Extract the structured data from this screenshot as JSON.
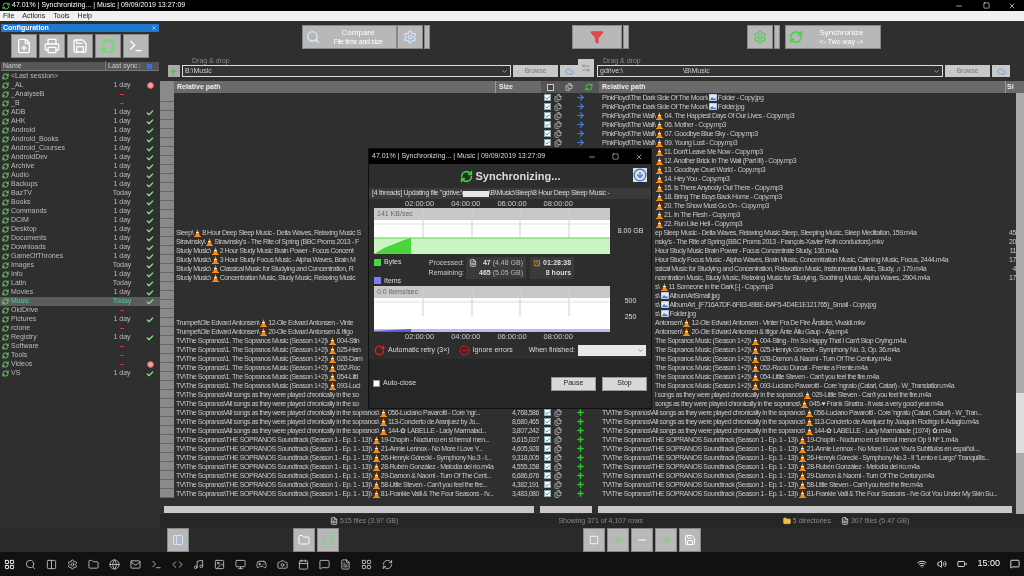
{
  "window": {
    "title": "47.01% | Synchronizing... | Music | 09/09/2019 13:27:09"
  },
  "menu": [
    "File",
    "Actions",
    "Tools",
    "Help"
  ],
  "config_panel": {
    "title": "Configuration",
    "columns": [
      "Name",
      "Last sync"
    ],
    "items": [
      {
        "name": "<Last session>",
        "never_synced": false,
        "synced": false,
        "failed": false,
        "selected": false
      },
      {
        "name": "_AL",
        "last_sync": "1 day",
        "never_synced": false,
        "synced": false,
        "failed": true,
        "selected": false
      },
      {
        "name": "_AnalyseB",
        "never_synced": true,
        "synced": false,
        "failed": false,
        "selected": false
      },
      {
        "name": "_B",
        "never_synced": true,
        "synced": false,
        "failed": false,
        "selected": false
      },
      {
        "name": "ADB",
        "last_sync": "1 day",
        "never_synced": false,
        "synced": true,
        "failed": false,
        "selected": false
      },
      {
        "name": "AHK",
        "last_sync": "1 day",
        "never_synced": false,
        "synced": true,
        "failed": false,
        "selected": false
      },
      {
        "name": "Android",
        "last_sync": "1 day",
        "never_synced": false,
        "synced": true,
        "failed": false,
        "selected": false
      },
      {
        "name": "Android_Books",
        "last_sync": "1 day",
        "never_synced": false,
        "synced": true,
        "failed": false,
        "selected": false
      },
      {
        "name": "Android_Courses",
        "last_sync": "1 day",
        "never_synced": false,
        "synced": true,
        "failed": false,
        "selected": false
      },
      {
        "name": "AndroidDev",
        "last_sync": "1 day",
        "never_synced": false,
        "synced": true,
        "failed": false,
        "selected": false
      },
      {
        "name": "Archive",
        "last_sync": "1 day",
        "never_synced": false,
        "synced": true,
        "failed": false,
        "selected": false
      },
      {
        "name": "Audio",
        "last_sync": "1 day",
        "never_synced": false,
        "synced": true,
        "failed": false,
        "selected": false
      },
      {
        "name": "Backups",
        "last_sync": "1 day",
        "never_synced": false,
        "synced": true,
        "failed": false,
        "selected": false
      },
      {
        "name": "BazTV",
        "last_sync": "Today",
        "never_synced": false,
        "synced": true,
        "failed": false,
        "selected": false
      },
      {
        "name": "Books",
        "last_sync": "1 day",
        "never_synced": false,
        "synced": true,
        "failed": false,
        "selected": false
      },
      {
        "name": "Commands",
        "last_sync": "1 day",
        "never_synced": false,
        "synced": true,
        "failed": false,
        "selected": false
      },
      {
        "name": "DCIM",
        "last_sync": "1 day",
        "never_synced": false,
        "synced": true,
        "failed": false,
        "selected": false
      },
      {
        "name": "Desktop",
        "last_sync": "1 day",
        "never_synced": false,
        "synced": true,
        "failed": false,
        "selected": false
      },
      {
        "name": "Documents",
        "last_sync": "1 day",
        "never_synced": false,
        "synced": true,
        "failed": false,
        "selected": false
      },
      {
        "name": "Downloads",
        "last_sync": "1 day",
        "never_synced": false,
        "synced": true,
        "failed": false,
        "selected": false
      },
      {
        "name": "GameOfThrones",
        "last_sync": "1 day",
        "never_synced": false,
        "synced": true,
        "failed": false,
        "selected": false
      },
      {
        "name": "Images",
        "last_sync": "Today",
        "never_synced": false,
        "synced": true,
        "failed": false,
        "selected": false
      },
      {
        "name": "Info",
        "last_sync": "1 day",
        "never_synced": false,
        "synced": true,
        "failed": false,
        "selected": false
      },
      {
        "name": "Latin",
        "last_sync": "Today",
        "never_synced": false,
        "synced": true,
        "failed": false,
        "selected": false
      },
      {
        "name": "Movies",
        "last_sync": "1 day",
        "never_synced": false,
        "synced": true,
        "failed": false,
        "selected": false
      },
      {
        "name": "Music",
        "last_sync": "Today",
        "never_synced": false,
        "synced": true,
        "failed": false,
        "selected": true
      },
      {
        "name": "OldDrive",
        "never_synced": true,
        "synced": false,
        "failed": false,
        "selected": false
      },
      {
        "name": "Pictures",
        "last_sync": "1 day",
        "never_synced": false,
        "synced": true,
        "failed": false,
        "selected": false
      },
      {
        "name": "rclone",
        "never_synced": true,
        "synced": false,
        "failed": false,
        "selected": false
      },
      {
        "name": "Registry",
        "last_sync": "1 day",
        "never_synced": false,
        "synced": true,
        "failed": false,
        "selected": false
      },
      {
        "name": "Software",
        "never_synced": true,
        "synced": false,
        "failed": false,
        "selected": false
      },
      {
        "name": "Tools",
        "never_synced": true,
        "synced": false,
        "failed": false,
        "selected": false
      },
      {
        "name": "Videos",
        "never_synced": true,
        "synced": false,
        "failed": true,
        "selected": false
      },
      {
        "name": "VS",
        "last_sync": "1 day",
        "never_synced": false,
        "synced": true,
        "failed": false,
        "selected": false
      }
    ]
  },
  "toolbar": {
    "compare": {
      "label": "Compare",
      "sublabel": "File time and size"
    },
    "sync": {
      "label": "Synchronize",
      "sublabel": "<- Two way ->"
    }
  },
  "left_folder": {
    "hint": "Drag & drop",
    "value": "B:\\Music",
    "browse": "Browse"
  },
  "right_folder": {
    "hint": "Drag & drop",
    "value_parts": [
      "gdrive:\\",
      "\\B\\Music"
    ],
    "browse": "Browse"
  },
  "grid": {
    "left_columns": [
      "Relative path",
      "Size"
    ],
    "right_columns": [
      "Relative path",
      "Si"
    ],
    "rows": [
      {
        "checked": true,
        "new_file": false,
        "right": {
          "dir": "PinkFloyd\\The Dark Side Of The Moon\\",
          "kind": "image",
          "file": "Folder - Copy.jpg"
        }
      },
      {
        "checked": true,
        "new_file": false,
        "right": {
          "dir": "PinkFloyd\\The Dark Side Of The Moon\\",
          "kind": "image",
          "file": "Folder.jpg"
        }
      },
      {
        "checked": true,
        "new_file": false,
        "right": {
          "dir": "PinkFloyd\\The Wall\\",
          "kind": "audio",
          "file": "04. The Happiest Days Of Our Lives - Copy.mp3"
        }
      },
      {
        "checked": true,
        "new_file": false,
        "right": {
          "dir": "PinkFloyd\\The Wall\\",
          "kind": "audio",
          "file": "06. Mother - Copy.mp3"
        }
      },
      {
        "checked": true,
        "new_file": false,
        "right": {
          "dir": "PinkFloyd\\The Wall\\",
          "kind": "audio",
          "file": "07. Goodbye Blue Sky - Copy.mp3"
        }
      },
      {
        "checked": true,
        "new_file": false,
        "right": {
          "dir": "PinkFloyd\\The Wall\\",
          "kind": "audio",
          "file": "09. Young Lust - Copy.mp3"
        }
      },
      {
        "right": {
          "kind": "audio",
          "file": "11. Don't Leave Me Now - Copy.mp3"
        }
      },
      {
        "right": {
          "kind": "audio",
          "file": "12. Another Brick In The Wall (Part III) - Copy.mp3"
        }
      },
      {
        "right": {
          "kind": "audio",
          "file": "13. Goodbye Cruel World - Copy.mp3"
        }
      },
      {
        "right": {
          "kind": "audio",
          "file": "14. Hey You - Copy.mp3"
        }
      },
      {
        "right": {
          "kind": "audio",
          "file": "15. Is There Anybody Out There - Copy.mp3"
        }
      },
      {
        "right": {
          "kind": "audio",
          "file": "18. Bring The Boys Back Home - Copy.mp3"
        }
      },
      {
        "right": {
          "kind": "audio",
          "file": "20. The Show Must Go On - Copy.mp3"
        }
      },
      {
        "right": {
          "kind": "audio",
          "file": "21. In The Flesh - Copy.mp3"
        }
      },
      {
        "right": {
          "kind": "audio",
          "file": "22. Run Like Hell - Copy.mp3"
        }
      },
      {
        "left": {
          "dir": "Sleep\\",
          "kind": "audio",
          "file": "8 Hour Deep Sleep Music - Delta Waves, Relaxing Music S"
        },
        "right": {
          "file": "ep Sleep Music - Delta Waves, Relaxing Music Sleep, Sleeping Music, Sleep Meditation, 159.m4a"
        },
        "right_size": "45"
      },
      {
        "left": {
          "dir": "Stravinsky\\",
          "kind": "audio",
          "file": "Stravinsky's - The Rite of Spring (BBC Proms 2013 - F"
        },
        "right": {
          "file": "nsky's - The Rite of Spring (BBC Proms 2013 - François-Xavier Roth conductors).mkv"
        },
        "right_size": "20"
      },
      {
        "left": {
          "dir": "Study Music\\",
          "kind": "audio",
          "file": "2 Hour Study Music Brain Power - Focus Concent"
        },
        "right": {
          "file": "Hour Study Music Brain Power - Focus Concentrate Study, 130.m4a"
        },
        "right_size": "11"
      },
      {
        "left": {
          "dir": "Study Music\\",
          "kind": "audio",
          "file": "3 Hour Study Focus Music - Alpha Waves, Brain M"
        },
        "right": {
          "file": "Hour Study Focus Music - Alpha Waves, Brain Music, Concentration Music, Calming Music, Focus, 2444.m4a"
        },
        "right_size": "17"
      },
      {
        "left": {
          "dir": "Study Music\\",
          "kind": "audio",
          "file": "Classical Music for Studying and Concentration, R"
        },
        "right": {
          "file": "ssical Music for Studying and Concentration, Relaxation Music, Instrumental Music, Study, ♬179.m4a"
        },
        "right_size": "4"
      },
      {
        "left": {
          "dir": "Study Music\\",
          "kind": "audio",
          "file": "Concentration Music, Study Music, Relaxing Music"
        },
        "right": {
          "file": "ncentration Music, Study Music, Relaxing Music for Studying, Soothing Music, Alpha Waves, 2904.m4a"
        },
        "right_size": "17"
      },
      {
        "right": {
          "dir": "s\\",
          "kind": "audio",
          "file": "11 Someone in the Dark [-] - Copy.mp3"
        }
      },
      {
        "right": {
          "dir": "s\\",
          "kind": "image",
          "file": "AlbumArtSmall.jpg"
        }
      },
      {
        "right": {
          "dir": "s\\",
          "kind": "image",
          "file": "AlbumArt_{F716A7DF-6F83-49BE-BAF5-4D4E1E121765}_Small - Copy.jpg"
        }
      },
      {
        "right": {
          "dir": "s\\",
          "kind": "image",
          "file": "Folder.jpg"
        }
      },
      {
        "left": {
          "dir": "Trumpet\\Ole Edvard Antonsen\\",
          "kind": "audio",
          "file": "12-Ole Edvard Antonsen - Vinte"
        },
        "right": {
          "dir": "Antonsen\\",
          "kind": "audio",
          "file": "12-Ole Edvard Antonsen - Vinter Fra De Fire Årstider, Vivaldi.mkv"
        }
      },
      {
        "left": {
          "dir": "Trumpet\\Ole Edvard Antonsen\\",
          "kind": "audio",
          "file": "20-Ole Edvard Antonsen & Ifigo"
        },
        "right": {
          "dir": "Antonsen\\",
          "kind": "audio",
          "file": "20-Ole Edvard Antonsen & Ifigor Ánte Áilu Gaup - Ája.mp4"
        }
      },
      {
        "left": {
          "dir": "TV\\The Sopranos\\1. The Sopranos Music (Season 1+2)\\",
          "kind": "audio",
          "file": "004-Stin"
        },
        "right": {
          "dir": "The Sopranos Music (Season 1+2)\\",
          "kind": "audio",
          "file": "004-Sting - I'm So Happy That I Can't Stop Crying.m4a"
        }
      },
      {
        "left": {
          "dir": "TV\\The Sopranos\\1. The Sopranos Music (Season 1+2)\\",
          "kind": "audio",
          "file": "025-Hen"
        },
        "right": {
          "dir": "The Sopranos Music (Season 1+2)\\",
          "kind": "audio",
          "file": "025-Henryk Górecki - Symphony No. 3, Op. 36.m4a"
        }
      },
      {
        "left": {
          "dir": "TV\\The Sopranos\\1. The Sopranos Music (Season 1+2)\\",
          "kind": "audio",
          "file": "028-Dam"
        },
        "right": {
          "dir": "The Sopranos Music (Season 1+2)\\",
          "kind": "audio",
          "file": "028-Damon & Naomi - Turn Of The Century.m4a"
        }
      },
      {
        "left": {
          "dir": "TV\\The Sopranos\\1. The Sopranos Music (Season 1+2)\\",
          "kind": "audio",
          "file": "052-Roc"
        },
        "right": {
          "dir": "The Sopranos Music (Season 1+2)\\",
          "kind": "audio",
          "file": "052-Rocío Dúrcal - Frente a Frente.m4a"
        }
      },
      {
        "left": {
          "dir": "TV\\The Sopranos\\1. The Sopranos Music (Season 1+2)\\",
          "kind": "audio",
          "file": "054-Littl"
        },
        "right": {
          "dir": "The Sopranos Music (Season 1+2)\\",
          "kind": "audio",
          "file": "054-Little Steven - Can't you feel the fire.m4a"
        }
      },
      {
        "left": {
          "dir": "TV\\The Sopranos\\1. The Sopranos Music (Season 1+2)\\",
          "kind": "audio",
          "file": "093-Luci"
        },
        "right": {
          "dir": "The Sopranos Music (Season 1+2)\\",
          "kind": "audio",
          "file": "093-Luciano Pavarotti - Core 'ngrato (Catari, Catari) - W_Translation.m4a"
        }
      },
      {
        "left": {
          "dir": "TV\\The Sopranos\\All songs as they were played chronically in the so"
        },
        "right": {
          "dir": "l songs as they were played chronically in the sopranos\\",
          "kind": "audio",
          "file": "029-Little Steven - Can't you feel the fire.m4a"
        }
      },
      {
        "left": {
          "dir": "TV\\The Sopranos\\All songs as they were played chronically in the so"
        },
        "right": {
          "dir": "songs as they were played chronically in the sopranos\\",
          "kind": "audio",
          "file": "045-♥ Frank Sinatra - It was a very good year.m4a"
        }
      },
      {
        "left": {
          "dir": "TV\\The Sopranos\\All songs as they were played chronically in the sopranos\\",
          "kind": "audio",
          "file": "056-Luciano Pavarotti - Core 'ngr..."
        },
        "size": "4,768,586",
        "checked": true,
        "new_file": true,
        "right": {
          "dir": "TV\\The Sopranos\\All songs as they were played chronically in the sopranos\\",
          "kind": "audio",
          "file": "056-Luciano Pavarotti - Core 'ngrato (Catari, Catari) - W_Tran..."
        }
      },
      {
        "left": {
          "dir": "TV\\The Sopranos\\All songs as they were played chronically in the sopranos\\",
          "kind": "audio",
          "file": "113-Concierto de Aranjuez by Jo..."
        },
        "size": "8,680,465",
        "checked": true,
        "new_file": true,
        "right": {
          "dir": "TV\\The Sopranos\\All songs as they were played chronically in the sopranos\\",
          "kind": "audio",
          "file": "113-Concierto de Aranjuez by Joaquín Rodrigo II-Adagio.m4a"
        }
      },
      {
        "left": {
          "dir": "TV\\The Sopranos\\All songs as they were played chronically in the sopranos\\",
          "kind": "audio",
          "file": "144-✿ LABELLE - Lady Marmalad..."
        },
        "size": "3,807,242",
        "checked": true,
        "new_file": true,
        "right": {
          "dir": "TV\\The Sopranos\\All songs as they were played chronically in the sopranos\\",
          "kind": "audio",
          "file": "144-✿ LABELLE - Lady Marmalade (1974) ✿.m4a"
        }
      },
      {
        "left": {
          "dir": "TV\\The Sopranos\\THE SOPRANOS Soundtrack (Season 1 - Ep. 1 - 13)\\",
          "kind": "audio",
          "file": "19-Chopin - Nocturno en si bemol men..."
        },
        "size": "5,615,037",
        "checked": true,
        "new_file": true,
        "right": {
          "dir": "TV\\The Sopranos\\THE SOPRANOS Soundtrack (Season 1 - Ep. 1 - 13)\\",
          "kind": "audio",
          "file": "19-Chopin - Nocturno en si bemol menor Op 9 Nº 1.m4a"
        }
      },
      {
        "left": {
          "dir": "TV\\The Sopranos\\THE SOPRANOS Soundtrack (Season 1 - Ep. 1 - 13)\\",
          "kind": "audio",
          "file": "21-Annie Lennox   -   No More I Love Y..."
        },
        "size": "4,605,928",
        "checked": true,
        "new_file": true,
        "right": {
          "dir": "TV\\The Sopranos\\THE SOPRANOS Soundtrack (Season 1 - Ep. 1 - 13)\\",
          "kind": "audio",
          "file": "21-Annie Lennox   -   No More I Love You's   Subtitulos en español...."
        }
      },
      {
        "left": {
          "dir": "TV\\The Sopranos\\THE SOPRANOS Soundtrack (Season 1 - Ep. 1 - 13)\\",
          "kind": "audio",
          "file": "26-Henryk Górecki - Symphony No.3 - I..."
        },
        "size": "9,318,005",
        "checked": true,
        "new_file": true,
        "right": {
          "dir": "TV\\The Sopranos\\THE SOPRANOS Soundtrack (Season 1 - Ep. 1 - 13)\\",
          "kind": "audio",
          "file": "26-Henryk Górecki - Symphony No.3 - II ''Lento e Largo'' Tranquillis..."
        }
      },
      {
        "left": {
          "dir": "TV\\The Sopranos\\THE SOPRANOS Soundtrack (Season 1 - Ep. 1 - 13)\\",
          "kind": "audio",
          "file": "28-Rubén González - Melodía del río.m4a"
        },
        "size": "4,555,158",
        "checked": true,
        "new_file": true,
        "right": {
          "dir": "TV\\The Sopranos\\THE SOPRANOS Soundtrack (Season 1 - Ep. 1 - 13)\\",
          "kind": "audio",
          "file": "28-Rubén González - Melodía del río.m4a"
        }
      },
      {
        "left": {
          "dir": "TV\\The Sopranos\\THE SOPRANOS Soundtrack (Season 1 - Ep. 1 - 13)\\",
          "kind": "audio",
          "file": "29-Damon & Naomi - Turn Of The Cent..."
        },
        "size": "6,686,676",
        "checked": true,
        "new_file": true,
        "right": {
          "dir": "TV\\The Sopranos\\THE SOPRANOS Soundtrack (Season 1 - Ep. 1 - 13)\\",
          "kind": "audio",
          "file": "29-Damon & Naomi - Turn Of The Century.m4a"
        }
      },
      {
        "left": {
          "dir": "TV\\The Sopranos\\THE SOPRANOS Soundtrack (Season 1 - Ep. 1 - 13)\\",
          "kind": "audio",
          "file": "58-Little Steven - Can't you feel the fire..."
        },
        "size": "4,382,191",
        "checked": true,
        "new_file": true,
        "right": {
          "dir": "TV\\The Sopranos\\THE SOPRANOS Soundtrack (Season 1 - Ep. 1 - 13)\\",
          "kind": "audio",
          "file": "58-Little Steven - Can't you feel the fire.m4a"
        }
      },
      {
        "left": {
          "dir": "TV\\The Sopranos\\THE SOPRANOS Soundtrack (Season 1 - Ep. 1 - 13)\\",
          "kind": "audio",
          "file": "81-Frankie Valli & The Four Seasons - I'v..."
        },
        "size": "3,483,080",
        "checked": true,
        "new_file": true,
        "right": {
          "dir": "TV\\The Sopranos\\THE SOPRANOS Soundtrack (Season 1 - Ep. 1 - 13)\\",
          "kind": "audio",
          "file": "81-Frankie Valli & The Four Seasons - I've Got You Under My Skin Su..."
        }
      }
    ]
  },
  "status_bar": {
    "left": "515 files (3.97 GB)",
    "rows": "Showing 371 of 4,107 rows",
    "directories": "5 directories",
    "files": "307 files (5.47 GB)"
  },
  "dialog": {
    "title": "47.01% | Synchronizing... | Music | 09/09/2019 13:27:09",
    "heading": "Synchronizing...",
    "status_parts": [
      "[4 threads] Updating file \"gdrive:\\",
      "\\B\\Music\\Sleep\\8 Hour Deep Sleep Music -"
    ],
    "time_ticks_top": [
      "02:00:00",
      "04:00:00",
      "06:00:00",
      "08:00:00"
    ],
    "time_ticks_bottom": [
      "02:00:00",
      "04:00:00",
      "06:00:00",
      "08:00:00"
    ],
    "bytes_chart": {
      "rate": "141 KB/sec",
      "axis_label": "8.00 GB",
      "legend": "Bytes"
    },
    "items_chart": {
      "rate": "0.0 items/sec",
      "axis_labels": [
        "500",
        "250"
      ],
      "legend": "Items"
    },
    "stats": [
      {
        "label": "Processed:",
        "count": "47",
        "size": "(4.48 GB)",
        "time": "01:28:38"
      },
      {
        "label": "Remaining:",
        "count": "465",
        "size": "(5.05 GB)",
        "time": "8 hours"
      }
    ],
    "options": {
      "retry": "Automatic retry (3×)",
      "ignore": "Ignore errors",
      "when_finished": "When finished:"
    },
    "auto_close": {
      "label": "Auto-close",
      "checked": false
    },
    "buttons": [
      "Pause",
      "Stop"
    ]
  },
  "clock": "15:00"
}
